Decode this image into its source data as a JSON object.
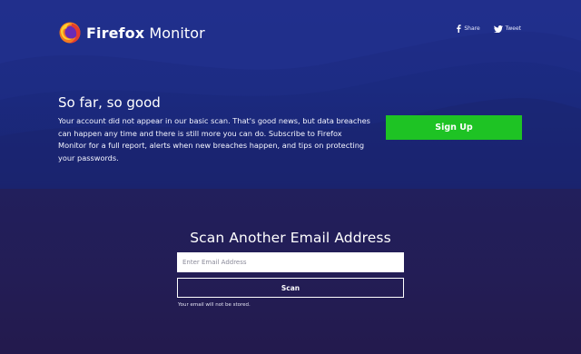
{
  "brand": {
    "name_bold": "Firefox",
    "name_regular": "Monitor"
  },
  "social": {
    "share_label": "Share",
    "share_icon": "facebook-icon",
    "tweet_label": "Tweet",
    "tweet_icon": "twitter-bird-icon"
  },
  "result": {
    "title": "So far, so good",
    "body": "Your account did not appear in our basic scan. That's good news, but data breaches can happen any time and there is still more you can do. Subscribe to Firefox Monitor for a full report, alerts when new breaches happen, and tips on protecting your passwords.",
    "signup_label": "Sign Up"
  },
  "scan": {
    "title": "Scan Another Email Address",
    "email_placeholder": "Enter Email Address",
    "email_value": "",
    "button_label": "Scan",
    "privacy_note": "Your email will not be stored."
  },
  "colors": {
    "hero_background": "#1d2a86",
    "scan_background": "#231d55",
    "signup_green": "#1ec324",
    "text": "#ffffff"
  }
}
